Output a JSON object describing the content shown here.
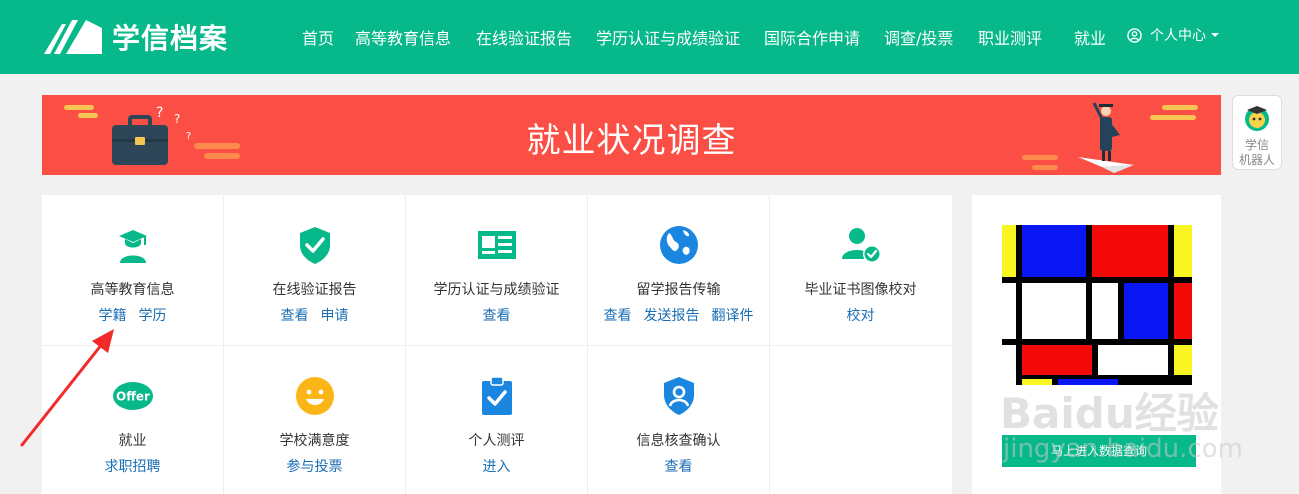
{
  "header": {
    "logo_text": "学信档案",
    "nav": [
      {
        "label": "首页"
      },
      {
        "label": "高等教育信息"
      },
      {
        "label": "在线验证报告"
      },
      {
        "label": "学历认证与成绩验证"
      },
      {
        "label": "国际合作申请"
      },
      {
        "label": "调查/投票"
      },
      {
        "label": "职业测评"
      },
      {
        "label": "就业"
      }
    ],
    "user_center": "个人中心"
  },
  "banner": {
    "title": "就业状况调查"
  },
  "robot": {
    "label_line1": "学信",
    "label_line2": "机器人"
  },
  "services": [
    {
      "title": "高等教育信息",
      "icon": "graduate-icon",
      "links": [
        "学籍",
        "学历"
      ]
    },
    {
      "title": "在线验证报告",
      "icon": "shield-check-icon",
      "links": [
        "查看",
        "申请"
      ]
    },
    {
      "title": "学历认证与成绩验证",
      "icon": "id-card-icon",
      "links": [
        "查看"
      ]
    },
    {
      "title": "留学报告传输",
      "icon": "globe-icon",
      "links": [
        "查看",
        "发送报告",
        "翻译件"
      ]
    },
    {
      "title": "毕业证书图像校对",
      "icon": "user-check-icon",
      "links": [
        "校对"
      ]
    },
    {
      "title": "就业",
      "icon": "offer-icon",
      "links": [
        "求职招聘"
      ]
    },
    {
      "title": "学校满意度",
      "icon": "smile-icon",
      "links": [
        "参与投票"
      ]
    },
    {
      "title": "个人测评",
      "icon": "clipboard-check-icon",
      "links": [
        "进入"
      ]
    },
    {
      "title": "信息核查确认",
      "icon": "user-shield-icon",
      "links": [
        "查看"
      ]
    }
  ],
  "offer_badge": "Offer",
  "ad": {
    "button_label": "马上进入数据查询"
  },
  "watermark": {
    "line1": "Baidu经验",
    "line2": "jingyan.baidu.com"
  },
  "colors": {
    "brand": "#07b98a",
    "banner": "#fb4f45",
    "link": "#1a6fb5"
  }
}
